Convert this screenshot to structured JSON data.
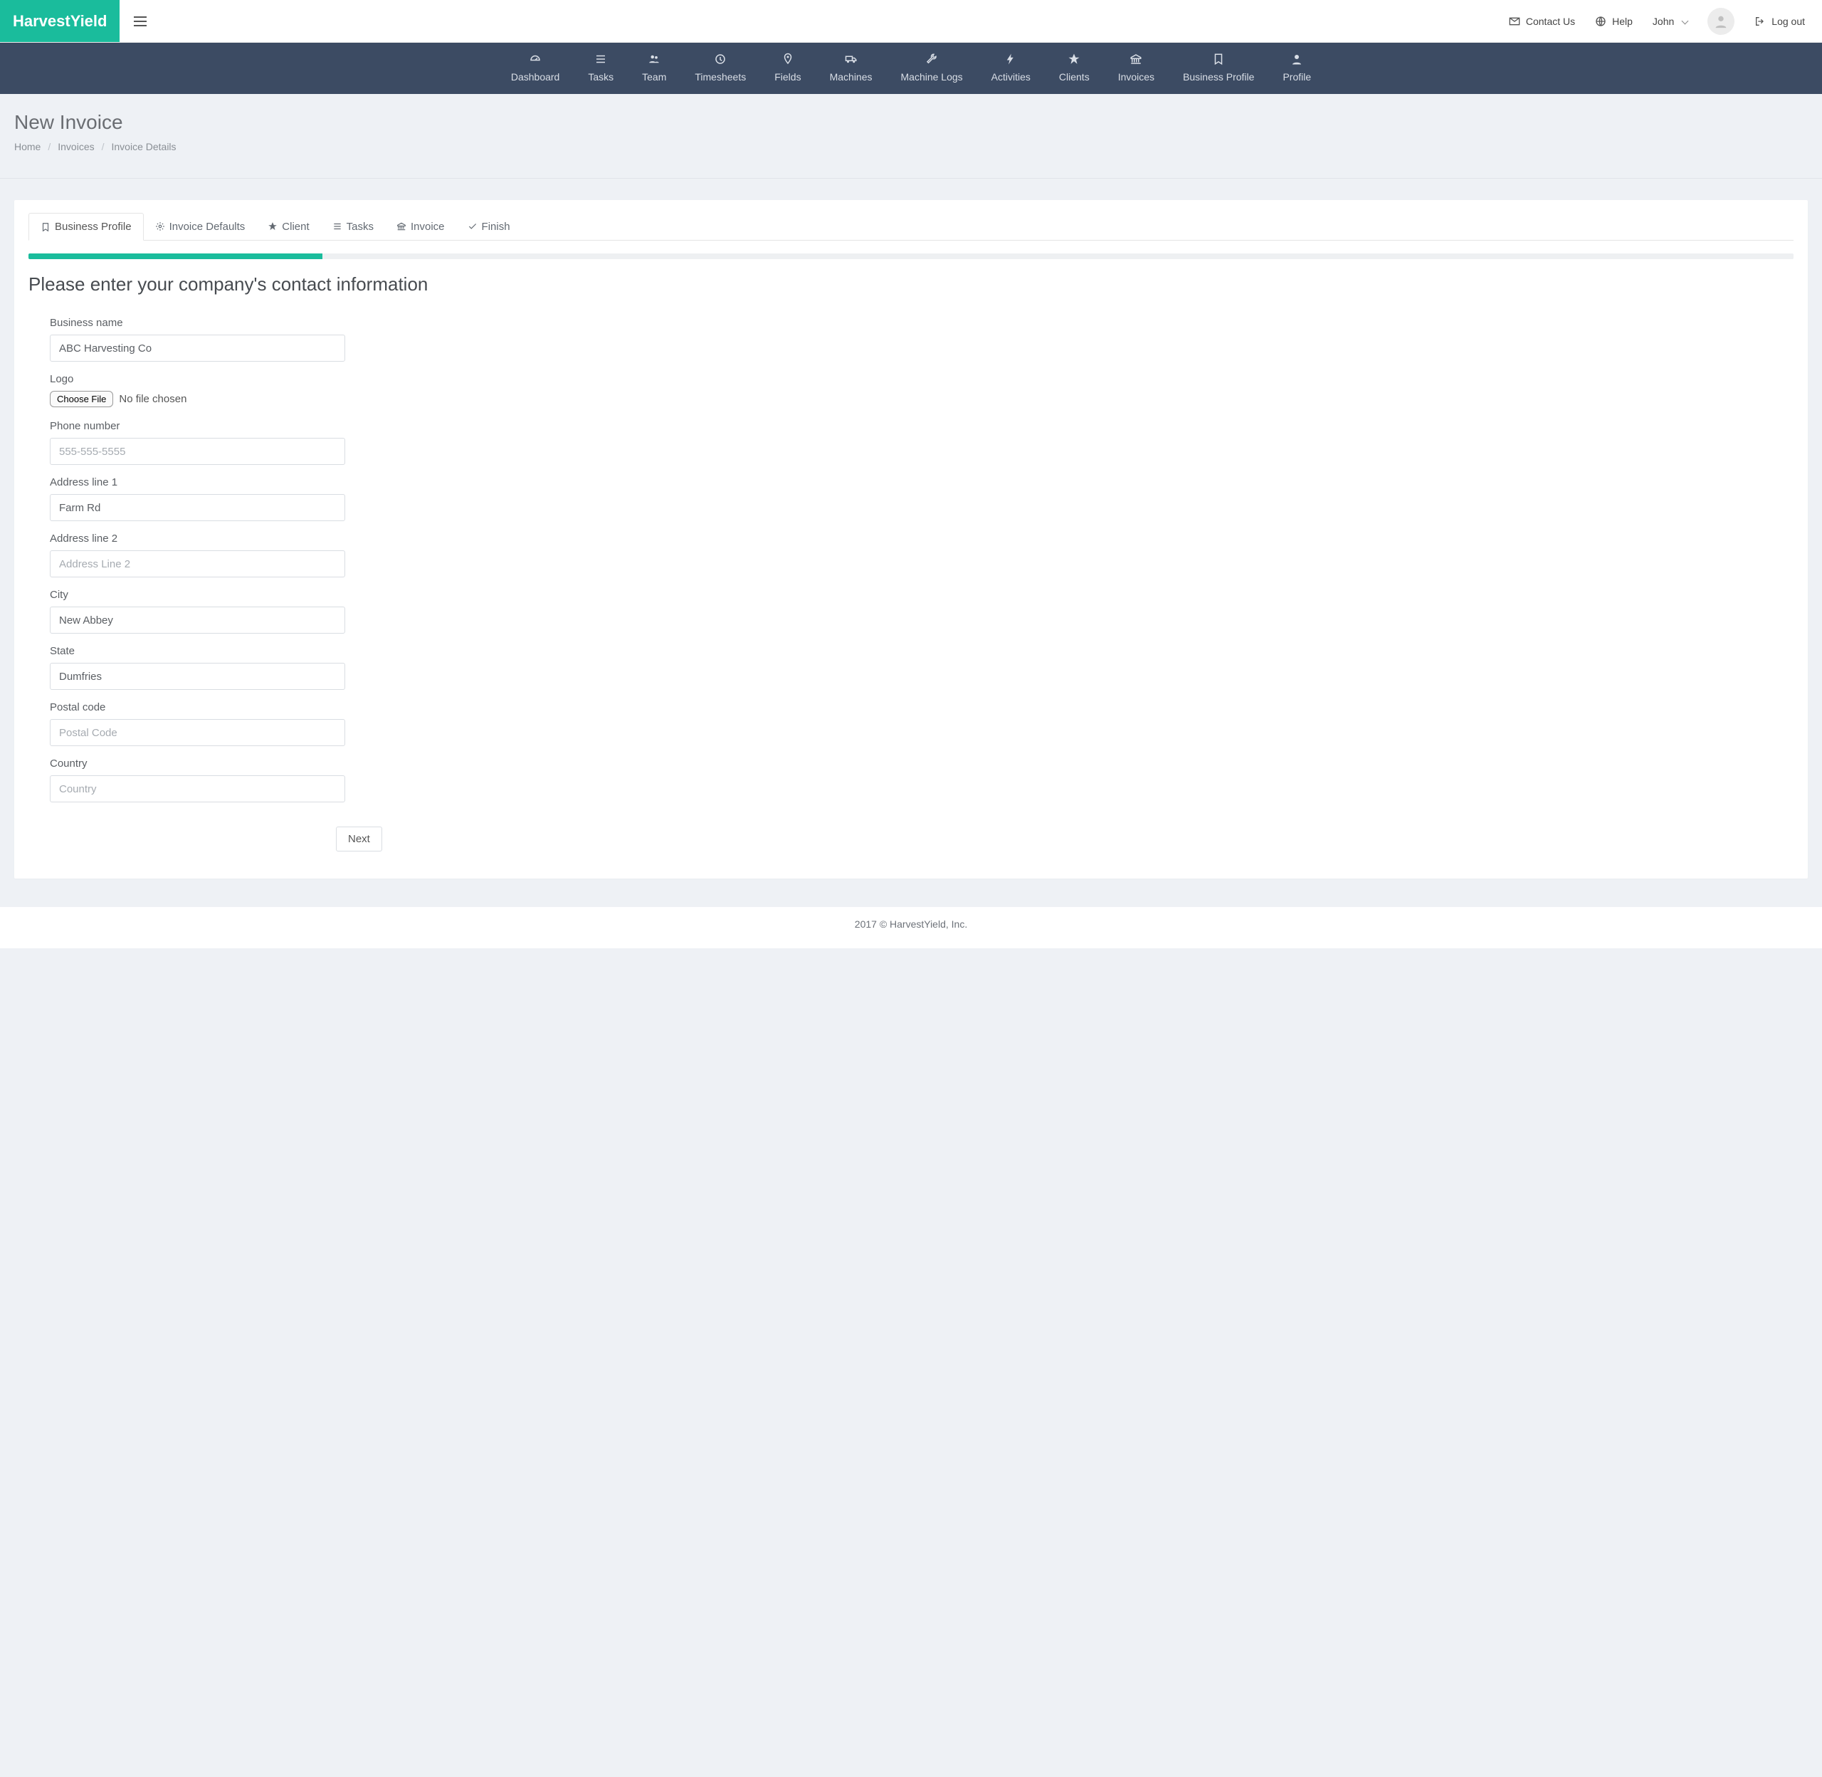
{
  "brand": "HarvestYield",
  "topbar": {
    "contact": "Contact Us",
    "help": "Help",
    "user": "John",
    "logout": "Log out"
  },
  "nav": {
    "items": [
      {
        "label": "Dashboard"
      },
      {
        "label": "Tasks"
      },
      {
        "label": "Team"
      },
      {
        "label": "Timesheets"
      },
      {
        "label": "Fields"
      },
      {
        "label": "Machines"
      },
      {
        "label": "Machine Logs"
      },
      {
        "label": "Activities"
      },
      {
        "label": "Clients"
      },
      {
        "label": "Invoices"
      },
      {
        "label": "Business Profile"
      },
      {
        "label": "Profile"
      }
    ]
  },
  "page": {
    "title": "New Invoice",
    "breadcrumb": {
      "home": "Home",
      "invoices": "Invoices",
      "current": "Invoice Details"
    }
  },
  "tabs": {
    "business_profile": "Business Profile",
    "invoice_defaults": "Invoice Defaults",
    "client": "Client",
    "tasks": "Tasks",
    "invoice": "Invoice",
    "finish": "Finish"
  },
  "section_heading": "Please enter your company's contact information",
  "form": {
    "business_name": {
      "label": "Business name",
      "value": "ABC Harvesting Co"
    },
    "logo": {
      "label": "Logo",
      "button": "Choose File",
      "status": "No file chosen"
    },
    "phone": {
      "label": "Phone number",
      "placeholder": "555-555-5555",
      "value": ""
    },
    "address1": {
      "label": "Address line 1",
      "value": "Farm Rd"
    },
    "address2": {
      "label": "Address line 2",
      "placeholder": "Address Line 2",
      "value": ""
    },
    "city": {
      "label": "City",
      "value": "New Abbey"
    },
    "state": {
      "label": "State",
      "value": "Dumfries"
    },
    "postal": {
      "label": "Postal code",
      "placeholder": "Postal Code",
      "value": ""
    },
    "country": {
      "label": "Country",
      "placeholder": "Country",
      "value": ""
    },
    "next": "Next"
  },
  "footer": "2017 © HarvestYield, Inc."
}
